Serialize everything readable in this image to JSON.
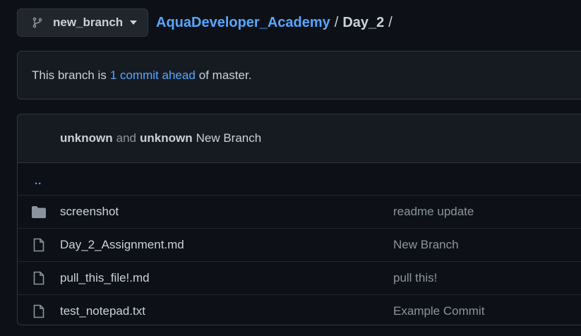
{
  "branch_selector": {
    "label": "new_branch",
    "icon": "git-branch-icon"
  },
  "breadcrumb": {
    "repo": "AquaDeveloper_Academy",
    "separator": "/",
    "dir": "Day_2",
    "trailing_separator": "/"
  },
  "ahead_notice": {
    "prefix": "This branch is",
    "link_text": "1 commit ahead",
    "suffix": "of master."
  },
  "latest_commit": {
    "author1": "unknown",
    "conjunction": "and",
    "author2": "unknown",
    "message": "New Branch"
  },
  "parent_dir_link": "..",
  "files": [
    {
      "type": "folder",
      "icon": "folder-icon",
      "name": "screenshot",
      "commit": "readme update"
    },
    {
      "type": "file",
      "icon": "file-icon",
      "name": "Day_2_Assignment.md",
      "commit": "New Branch"
    },
    {
      "type": "file",
      "icon": "file-icon",
      "name": "pull_this_file!.md",
      "commit": "pull this!"
    },
    {
      "type": "file",
      "icon": "file-icon",
      "name": "test_notepad.txt",
      "commit": "Example Commit"
    }
  ],
  "colors": {
    "background": "#0d1117",
    "surface": "#161b22",
    "border": "#30363d",
    "link": "#58a6ff",
    "text": "#c9d1d9",
    "muted": "#8b949e"
  }
}
